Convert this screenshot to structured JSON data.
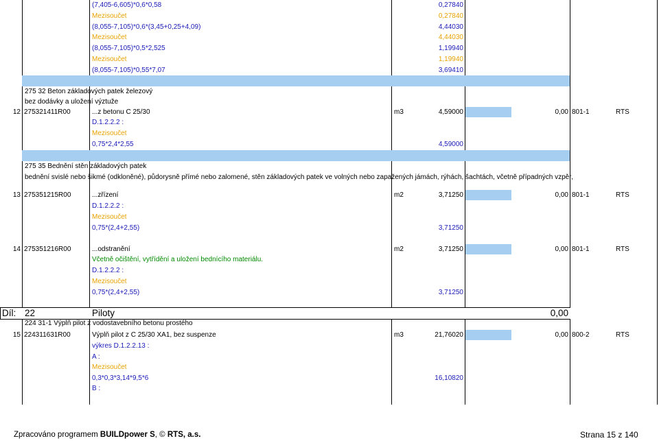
{
  "colors": {
    "formula": "#1a1ab8",
    "subtotal": "#e8a200",
    "note": "#008a00",
    "highlight_band": "#a6cef0"
  },
  "rows": [
    {
      "desc": "(7,405-6,605)*0,6*0,58",
      "qty": "0,27840"
    },
    {
      "desc": "Mezisoučet",
      "qty": "0,27840"
    },
    {
      "desc": "(8,055-7,105)*0,6*(3,45+0,25+4,09)",
      "qty": "4,44030"
    },
    {
      "desc": "Mezisoučet",
      "qty": "4,44030"
    },
    {
      "desc": "(8,055-7,105)*0,5*2,525",
      "qty": "1,19940"
    },
    {
      "desc": "Mezisoučet",
      "qty": "1,19940"
    },
    {
      "desc": "(8,055-7,105)*0,55*7,07",
      "qty": "3,69410"
    },
    {
      "group": "275 32 Beton základových patek železový"
    },
    {
      "group": "bez dodávky a uložení výztuže"
    },
    {
      "num": "12",
      "code": "275321411R00",
      "desc": "...z betonu C 25/30",
      "unit": "m3",
      "qty": "4,59000",
      "total": "0,00",
      "catalog": "801-1",
      "source": "RTS"
    },
    {
      "desc": "D.1.2.2.2 :"
    },
    {
      "desc": "Mezisoučet"
    },
    {
      "desc": "0,75*2,4*2,55",
      "qty": "4,59000"
    },
    {
      "group": "275 35 Bednění stěn základových patek"
    },
    {
      "group": "bednění svislé nebo šikmé (odkloněné), půdorysně přímé nebo zalomené, stěn základových patek ve volných nebo zapažených jámách, rýhách, šachtách, včetně případných vzpěr,"
    },
    {
      "num": "13",
      "code": "275351215R00",
      "desc": "...zřízení",
      "unit": "m2",
      "qty": "3,71250",
      "total": "0,00",
      "catalog": "801-1",
      "source": "RTS"
    },
    {
      "desc": "D.1.2.2.2 :"
    },
    {
      "desc": "Mezisoučet"
    },
    {
      "desc": "0,75*(2,4+2,55)",
      "qty": "3,71250"
    },
    {
      "num": "14",
      "code": "275351216R00",
      "desc": "...odstranění",
      "unit": "m2",
      "qty": "3,71250",
      "total": "0,00",
      "catalog": "801-1",
      "source": "RTS"
    },
    {
      "desc": "Včetně očištění, vytřídění a uložení bednícího materiálu."
    },
    {
      "desc": "D.1.2.2.2 :"
    },
    {
      "desc": "Mezisoučet"
    },
    {
      "desc": "0,75*(2,4+2,55)",
      "qty": "3,71250"
    },
    {
      "group": "224 31-1 Výplň pilot z vodostavebního betonu prostého"
    },
    {
      "num": "15",
      "code": "224311631R00",
      "desc": "Výplň pilot z C 25/30 XA1, bez suspenze",
      "unit": "m3",
      "qty": "21,76020",
      "total": "0,00",
      "catalog": "800-2",
      "source": "RTS"
    },
    {
      "desc": "výkres D.1.2.2.13 :"
    },
    {
      "desc": "A :"
    },
    {
      "desc": "Mezisoučet"
    },
    {
      "desc": "0,3*0,3*3,14*9,5*6",
      "qty": "16,10820"
    },
    {
      "desc": "B :"
    }
  ],
  "section": {
    "label": "Díl:",
    "number": "22",
    "name": "Piloty",
    "total": "0,00"
  },
  "footer": {
    "prefix": "Zpracováno programem ",
    "program": "BUILDpower S",
    "middle": ", © ",
    "company": "RTS, a.s.",
    "page": "Strana 15 z 140"
  }
}
